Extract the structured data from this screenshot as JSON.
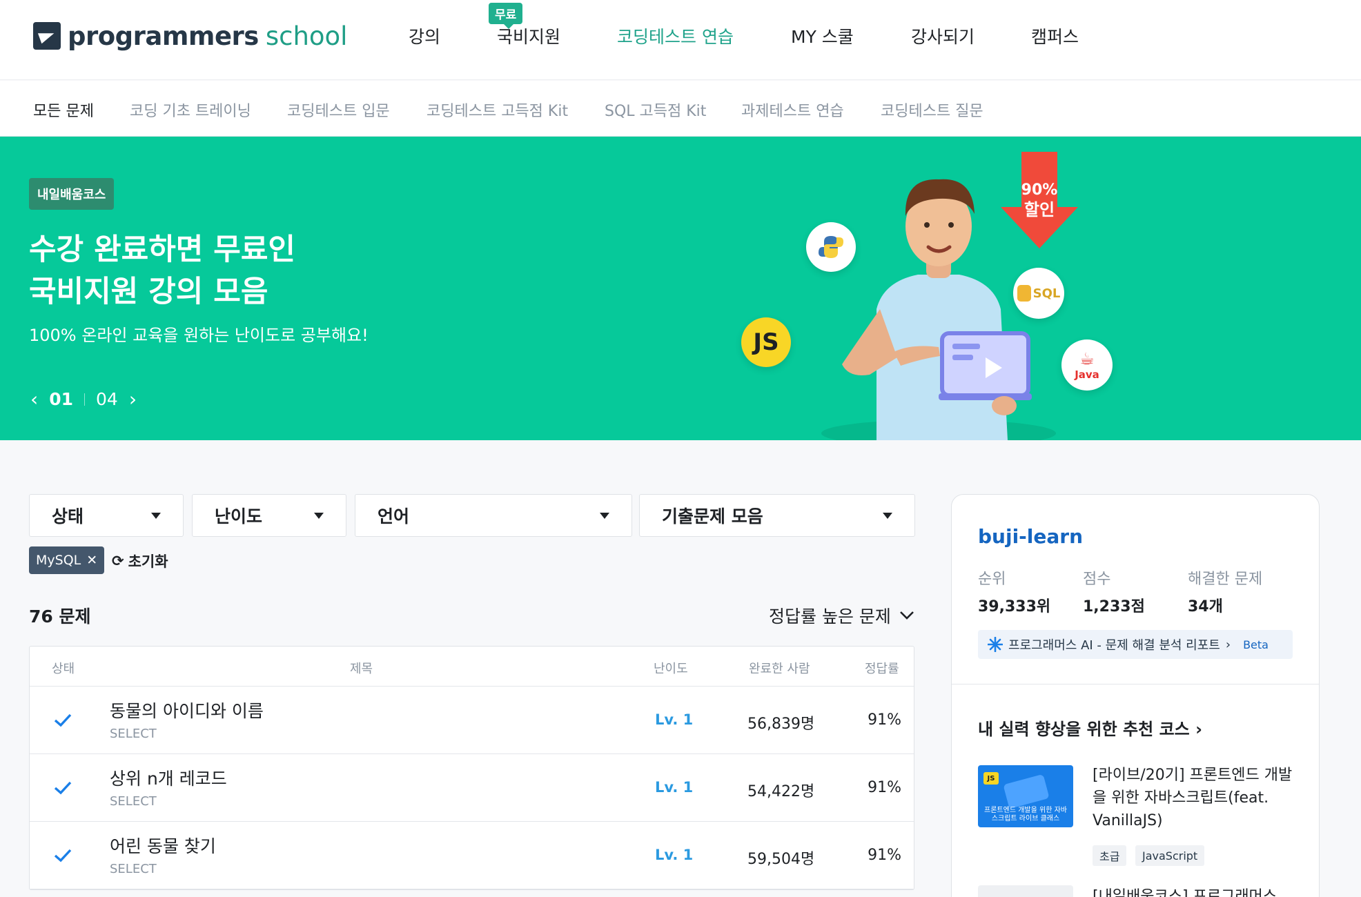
{
  "nav": {
    "logo_main": "programmers",
    "logo_sub": "school",
    "free_badge": "무료",
    "items": [
      "강의",
      "국비지원",
      "코딩테스트 연습",
      "MY 스쿨",
      "강사되기",
      "캠퍼스"
    ],
    "active": "코딩테스트 연습"
  },
  "subnav": {
    "items": [
      "모든 문제",
      "코딩 기초 트레이닝",
      "코딩테스트 입문",
      "코딩테스트 고득점 Kit",
      "SQL 고득점 Kit",
      "과제테스트 연습",
      "코딩테스트 질문"
    ]
  },
  "banner": {
    "tag": "내일배움코스",
    "title_line1": "수강 완료하면 무료인",
    "title_line2": "국비지원 강의 모음",
    "subtitle": "100% 온라인 교육을 원하는 난이도로 공부해요!",
    "page_current": "01",
    "page_total": "04",
    "sale_line1": "90%",
    "sale_line2": "할인",
    "bubble_js": "JS",
    "bubble_sql": "SQL",
    "bubble_java": "Java"
  },
  "filters": {
    "status": "상태",
    "difficulty": "난이도",
    "language": "언어",
    "collection": "기출문제 모음",
    "chip": "MySQL",
    "reset": "초기화"
  },
  "list": {
    "count": "76 문제",
    "sort": "정답률 높은 문제",
    "headers": [
      "상태",
      "제목",
      "난이도",
      "완료한 사람",
      "정답률"
    ],
    "rows": [
      {
        "title": "동물의 아이디와 이름",
        "category": "SELECT",
        "level": "Lv. 1",
        "completed": "56,839명",
        "rate": "91%"
      },
      {
        "title": "상위 n개 레코드",
        "category": "SELECT",
        "level": "Lv. 1",
        "completed": "54,422명",
        "rate": "91%"
      },
      {
        "title": "어린 동물 찾기",
        "category": "SELECT",
        "level": "Lv. 1",
        "completed": "59,504명",
        "rate": "91%"
      }
    ]
  },
  "profile": {
    "username": "buji-learn",
    "rank_label": "순위",
    "rank_value": "39,333위",
    "score_label": "점수",
    "score_value": "1,233점",
    "solved_label": "해결한 문제",
    "solved_value": "34개",
    "ai_report": "프로그래머스 AI - 문제 해결 분석 리포트",
    "ai_beta": "Beta",
    "rec_title": "내 실력 향상을 위한 추천 코스",
    "course1_title": "[라이브/20기] 프론트엔드 개발을 위한 자바스크립트(feat. VanillaJS)",
    "course1_tag1": "초급",
    "course1_tag2": "JavaScript",
    "course1_thumb_text": "프론트엔드 개발을 위한 자바스크립트 라이브 클래스",
    "course2_title": "[내일배움코스] 프로그래머스"
  },
  "colors": {
    "brand_green": "#06c99a",
    "active_nav": "#20a38b",
    "level_blue": "#2b9ae0",
    "username_blue": "#1565c0"
  }
}
